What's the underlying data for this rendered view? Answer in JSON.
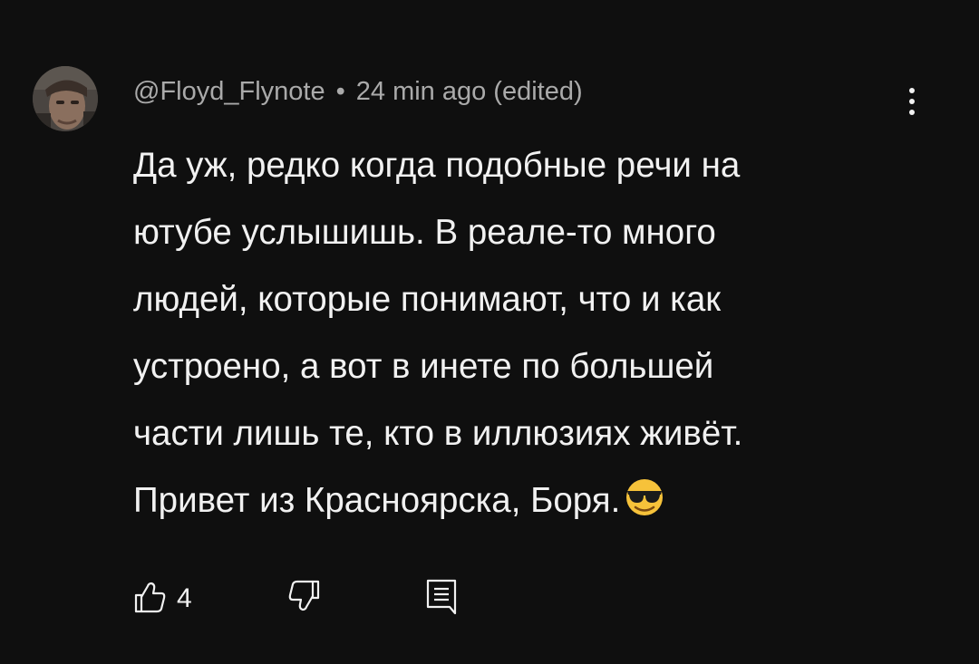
{
  "comment": {
    "author": "@Floyd_Flynote",
    "separator": "•",
    "timestamp": "24 min ago (edited)",
    "text_lines": [
      "Да уж, редко когда подобные речи на",
      "ютубе услышишь. В реале-то много",
      "людей, которые понимают, что и как",
      "устроено, а вот в инете по большей",
      "части лишь те, кто в иллюзиях живёт.",
      "Привет из Красноярска, Боря."
    ],
    "trailing_emoji": "smiling-face-with-sunglasses",
    "like_count": "4"
  },
  "icons": {
    "menu": "more-vert-icon",
    "like": "thumb-up-icon",
    "dislike": "thumb-down-icon",
    "reply": "reply-comment-icon"
  },
  "colors": {
    "background": "#0f0f0f",
    "text_primary": "#f1f1f1",
    "text_secondary": "#aaaaaa"
  }
}
